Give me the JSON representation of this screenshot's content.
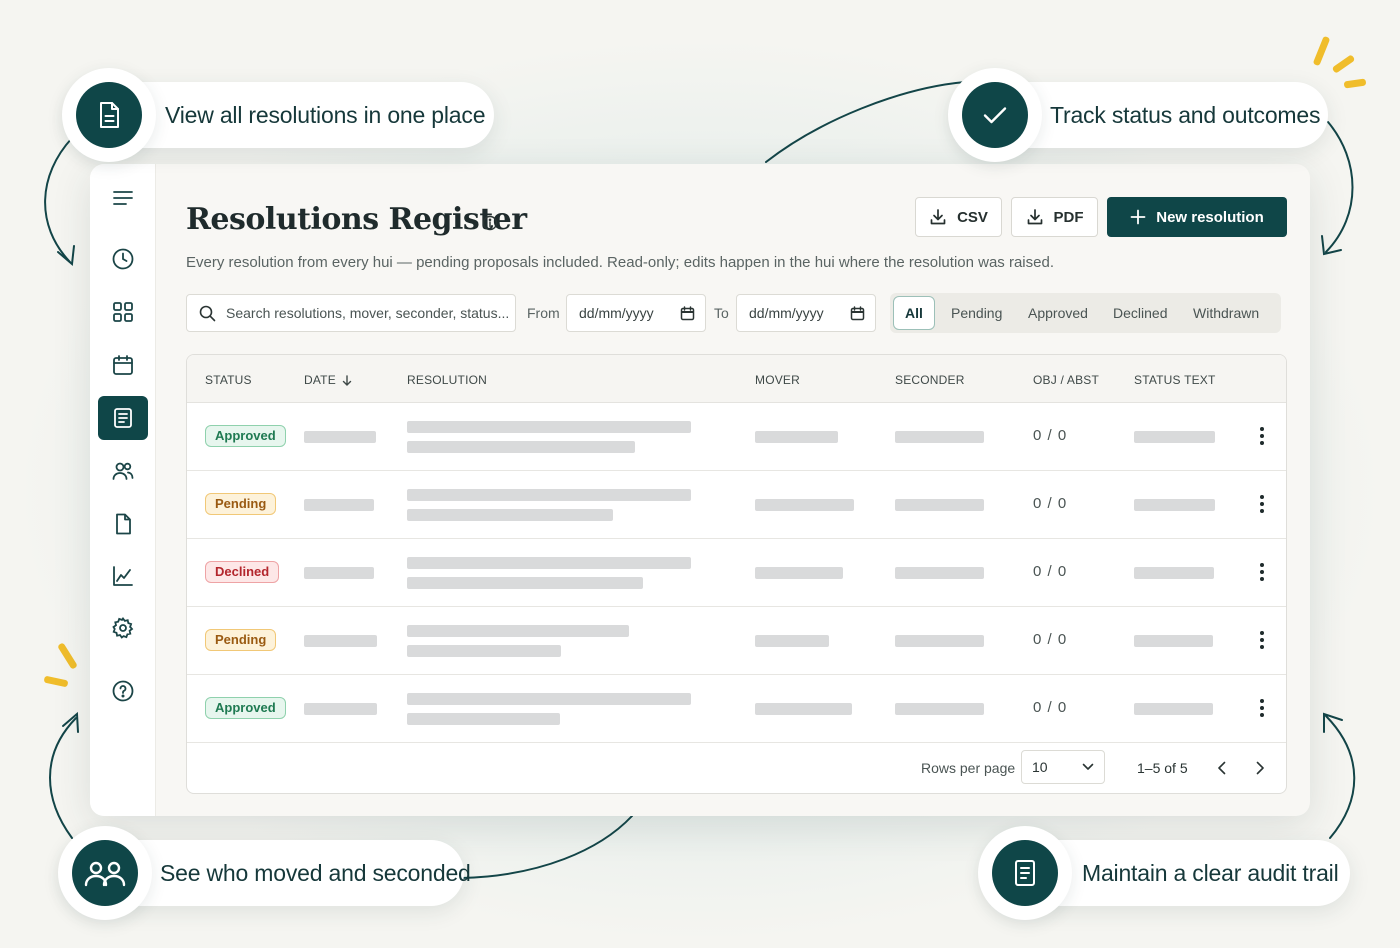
{
  "callouts": {
    "view_all": "View all resolutions in one place",
    "track": "Track status and outcomes",
    "moved": "See who moved and seconded",
    "audit": "Maintain a clear audit trail"
  },
  "header": {
    "title": "Resolutions Register",
    "subtitle": "Every resolution from every hui — pending proposals included. Read-only; edits happen in the hui where the resolution was raised.",
    "csv_label": "CSV",
    "pdf_label": "PDF",
    "new_label": "New resolution"
  },
  "filters": {
    "search_placeholder": "Search resolutions, mover, seconder, status...",
    "from_label": "From",
    "to_label": "To",
    "date_placeholder": "dd/mm/yyyy",
    "segments": [
      "All",
      "Pending",
      "Approved",
      "Declined",
      "Withdrawn"
    ],
    "active_segment": "All"
  },
  "table": {
    "columns": [
      "STATUS",
      "DATE",
      "RESOLUTION",
      "MOVER",
      "SECONDER",
      "OBJ / ABST",
      "STATUS TEXT"
    ],
    "sort_column": "DATE",
    "rows": [
      {
        "status": "Approved",
        "obj_abst": "0 / 0"
      },
      {
        "status": "Pending",
        "obj_abst": "0 / 0"
      },
      {
        "status": "Declined",
        "obj_abst": "0 / 0"
      },
      {
        "status": "Pending",
        "obj_abst": "0 / 0"
      },
      {
        "status": "Approved",
        "obj_abst": "0 / 0"
      }
    ],
    "footer": {
      "rows_per_page_label": "Rows per page",
      "rows_per_page": "10",
      "range": "1–5 of 5"
    }
  },
  "sidebar": {
    "icons": [
      "menu-icon",
      "clock-icon",
      "grid-icon",
      "calendar-icon",
      "register-icon",
      "users-icon",
      "document-icon",
      "chart-icon",
      "settings-icon",
      "help-icon"
    ],
    "active": "register-icon"
  },
  "colors": {
    "brand": "#0f4648",
    "approved": "#1f7a52",
    "pending": "#9a5a12",
    "declined": "#b3262d",
    "accent_spark": "#f0bd2b"
  }
}
